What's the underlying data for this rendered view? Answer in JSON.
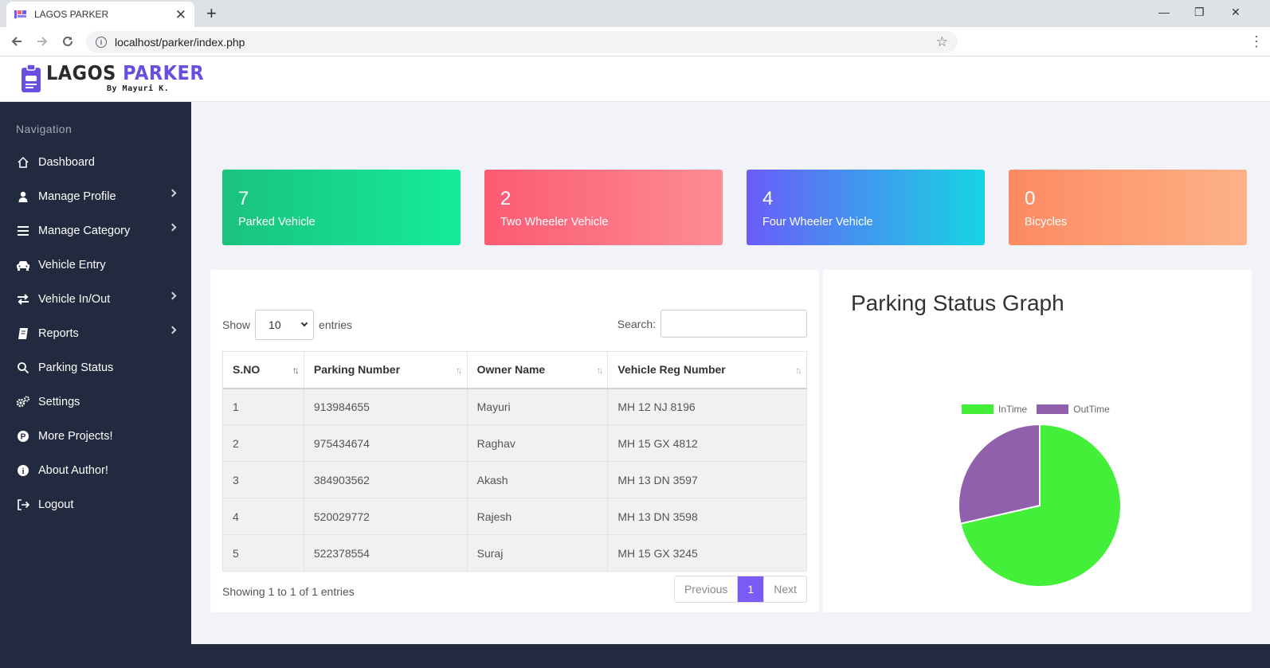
{
  "browser": {
    "tab_title": "LAGOS PARKER",
    "tab_close": "✕",
    "new_tab": "+",
    "url": "localhost/parker/index.php",
    "window_controls": [
      "—",
      "❐",
      "✕"
    ]
  },
  "brand": {
    "name_part1": "LAGOS",
    "name_part2": "PARKER",
    "byline": "By Mayuri K.",
    "accent": "#6a4ee0"
  },
  "sidebar": {
    "heading": "Navigation",
    "items": [
      {
        "label": "Dashboard",
        "icon": "home-icon",
        "has_submenu": false
      },
      {
        "label": "Manage Profile",
        "icon": "user-icon",
        "has_submenu": true
      },
      {
        "label": "Manage Category",
        "icon": "menu-icon",
        "has_submenu": true
      },
      {
        "label": "Vehicle Entry",
        "icon": "car-icon",
        "has_submenu": false
      },
      {
        "label": "Vehicle In/Out",
        "icon": "swap-icon",
        "has_submenu": true
      },
      {
        "label": "Reports",
        "icon": "book-icon",
        "has_submenu": true
      },
      {
        "label": "Parking Status",
        "icon": "search-icon",
        "has_submenu": false
      },
      {
        "label": "Settings",
        "icon": "gears-icon",
        "has_submenu": false
      },
      {
        "label": "More Projects!",
        "icon": "p-circle-icon",
        "has_submenu": false
      },
      {
        "label": "About Author!",
        "icon": "info-icon",
        "has_submenu": false
      },
      {
        "label": "Logout",
        "icon": "logout-icon",
        "has_submenu": false
      }
    ]
  },
  "stats": [
    {
      "value": "7",
      "label": "Parked Vehicle",
      "color": "#15ec9a"
    },
    {
      "value": "2",
      "label": "Two Wheeler Vehicle",
      "color": "#fc5a73"
    },
    {
      "value": "4",
      "label": "Four Wheeler Vehicle",
      "color": "#6a5cf9"
    },
    {
      "value": "0",
      "label": "Bicycles",
      "color": "#fd8a62"
    }
  ],
  "table": {
    "show_label": "Show",
    "length_value": "10",
    "entries_label": "entries",
    "search_label": "Search:",
    "search_value": "",
    "columns": [
      "S.NO",
      "Parking Number",
      "Owner Name",
      "Vehicle Reg Number"
    ],
    "rows": [
      [
        "1",
        "913984655",
        "Mayuri",
        "MH 12 NJ 8196"
      ],
      [
        "2",
        "975434674",
        "Raghav",
        "MH 15 GX 4812"
      ],
      [
        "3",
        "384903562",
        "Akash",
        "MH 13 DN 3597"
      ],
      [
        "4",
        "520029772",
        "Rajesh",
        "MH 13 DN 3598"
      ],
      [
        "5",
        "522378554",
        "Suraj",
        "MH 15 GX 3245"
      ]
    ],
    "info": "Showing 1 to 1 of 1 entries",
    "pager": {
      "previous": "Previous",
      "current": "1",
      "next": "Next"
    }
  },
  "chart_title": "Parking Status Graph",
  "chart_data": {
    "type": "pie",
    "title": "",
    "labels": [
      "InTime",
      "OutTime"
    ],
    "values": [
      5,
      2
    ],
    "colors": [
      "#44ef3a",
      "#9160ad"
    ]
  }
}
